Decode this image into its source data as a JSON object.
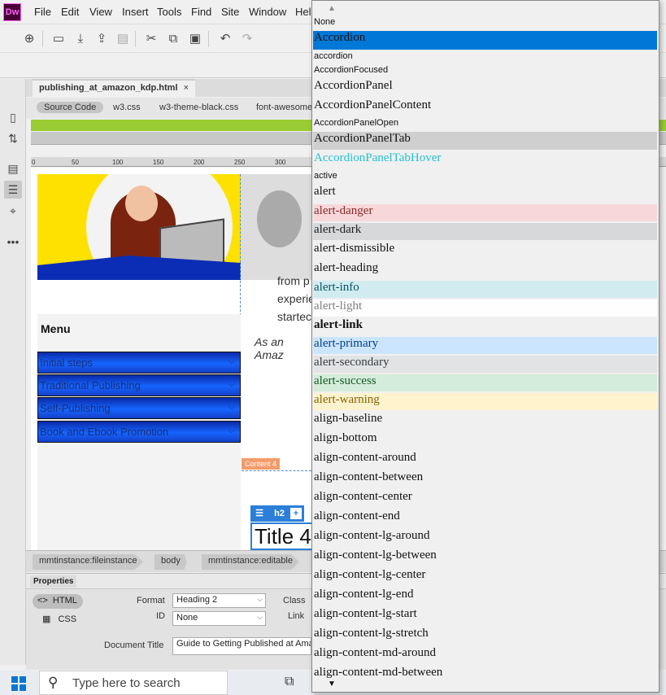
{
  "app": {
    "logo": "Dw",
    "menu": [
      "File",
      "Edit",
      "View",
      "Insert",
      "Tools",
      "Find",
      "Site",
      "Window",
      "Hel"
    ]
  },
  "toolbar": {
    "icons": [
      "new-file-icon",
      "open-icon",
      "get-icon",
      "put-icon",
      "print-icon",
      "cut-icon",
      "copy-icon",
      "paste-icon",
      "undo-icon",
      "redo-icon"
    ]
  },
  "document": {
    "tab_title": "publishing_at_amazon_kdp.html",
    "close_glyph": "×",
    "related_files": [
      "Source Code",
      "w3.css",
      "w3-theme-black.css",
      "font-awesome"
    ],
    "ruler_ticks": [
      "0",
      "50",
      "100",
      "150",
      "200",
      "250",
      "300"
    ]
  },
  "canvas": {
    "article_lines": [
      "from p",
      "experie",
      "startec"
    ],
    "amazon_text": "As an Amaz",
    "menu_title": "Menu",
    "menu_buttons": [
      "Initial steps",
      "Traditional Publishing",
      "Self-Publishing",
      "Book and Ebook Promotion"
    ],
    "chevron": "⌵",
    "content_label": "Content 4",
    "h2_tool_label": "h2",
    "h2_tool_plus": "+",
    "h2_text": "Title 4"
  },
  "tag_selector": [
    "mmtinstance:fileinstance",
    "body",
    "mmtinstance:editable"
  ],
  "properties": {
    "tab": "Properties",
    "html_btn": "HTML",
    "css_btn": "CSS",
    "format_label": "Format",
    "format_value": "Heading 2",
    "id_label": "ID",
    "id_value": "None",
    "class_label": "Class",
    "link_label": "Link",
    "doc_title_label": "Document Title",
    "doc_title_value": "Guide to Getting Published at Ama"
  },
  "taskbar": {
    "search_placeholder": "Type here to search"
  },
  "class_dropdown": {
    "up_arrow": "▲",
    "down_arrow": "▼",
    "items": [
      {
        "label": "None",
        "style": "small"
      },
      {
        "label": "Accordion",
        "style": "selected"
      },
      {
        "label": "accordion",
        "style": "small"
      },
      {
        "label": "AccordionFocused",
        "style": "small"
      },
      {
        "label": "AccordionPanel",
        "style": "serif"
      },
      {
        "label": "AccordionPanelContent",
        "style": "serif"
      },
      {
        "label": "AccordionPanelOpen",
        "style": "small"
      },
      {
        "label": "AccordionPanelTab",
        "style": "serif-gray"
      },
      {
        "label": "AccordionPanelTabHover",
        "style": "serif-cyan"
      },
      {
        "label": "active",
        "style": "small"
      },
      {
        "label": "alert",
        "style": "serif"
      },
      {
        "label": "alert-danger",
        "style": "danger"
      },
      {
        "label": "alert-dark",
        "style": "dark"
      },
      {
        "label": "alert-dismissible",
        "style": "serif"
      },
      {
        "label": "alert-heading",
        "style": "serif"
      },
      {
        "label": "alert-info",
        "style": "info"
      },
      {
        "label": "alert-light",
        "style": "light"
      },
      {
        "label": "alert-link",
        "style": "link"
      },
      {
        "label": "alert-primary",
        "style": "primary"
      },
      {
        "label": "alert-secondary",
        "style": "secondary"
      },
      {
        "label": "alert-success",
        "style": "success"
      },
      {
        "label": "alert-warning",
        "style": "warning"
      },
      {
        "label": "align-baseline",
        "style": "serif"
      },
      {
        "label": "align-bottom",
        "style": "serif"
      },
      {
        "label": "align-content-around",
        "style": "serif"
      },
      {
        "label": "align-content-between",
        "style": "serif"
      },
      {
        "label": "align-content-center",
        "style": "serif"
      },
      {
        "label": "align-content-end",
        "style": "serif"
      },
      {
        "label": "align-content-lg-around",
        "style": "serif"
      },
      {
        "label": "align-content-lg-between",
        "style": "serif"
      },
      {
        "label": "align-content-lg-center",
        "style": "serif"
      },
      {
        "label": "align-content-lg-end",
        "style": "serif"
      },
      {
        "label": "align-content-lg-start",
        "style": "serif"
      },
      {
        "label": "align-content-lg-stretch",
        "style": "serif"
      },
      {
        "label": "align-content-md-around",
        "style": "serif"
      },
      {
        "label": "align-content-md-between",
        "style": "serif"
      }
    ]
  },
  "colors": {
    "selected_bg": "#0078d7",
    "dw_logo_bg": "#470137",
    "dw_logo_fg": "#ff61f6",
    "menu_button_blue": "#1565ff",
    "green_bar": "#99cc33"
  }
}
